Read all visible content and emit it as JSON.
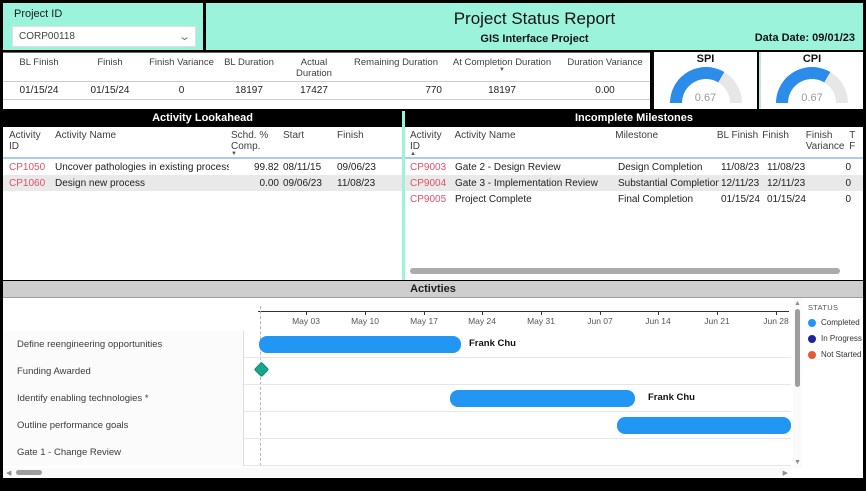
{
  "filter": {
    "label": "Project ID",
    "value": "CORP00118"
  },
  "header": {
    "title": "Project Status Report",
    "subtitle": "GIS Interface Project",
    "data_date": "Data Date: 09/01/23"
  },
  "summary": {
    "columns": [
      "BL Finish",
      "Finish",
      "Finish Variance",
      "BL Duration",
      "Actual Duration",
      "Remaining Duration",
      "At Completion Duration",
      "Duration Variance"
    ],
    "values": [
      "01/15/24",
      "01/15/24",
      "0",
      "18197",
      "17427",
      "770",
      "18197",
      "0.00"
    ],
    "sort": {
      "column": "At Completion Duration",
      "direction": "descending",
      "glyph": "▼"
    }
  },
  "gauges": {
    "spi": {
      "label": "SPI",
      "value": "0.67"
    },
    "cpi": {
      "label": "CPI",
      "value": "0.67"
    },
    "fill_color": "#2b8cea",
    "track_color": "#e7e7e7"
  },
  "lookahead": {
    "title": "Activity Lookahead",
    "columns": {
      "id": "Activity ID",
      "name": "Activity Name",
      "pct": "Schd. % Comp.",
      "start": "Start",
      "finish": "Finish"
    },
    "sort": {
      "column": "Schd. % Comp.",
      "direction": "descending",
      "glyph": "▼"
    },
    "rows": [
      {
        "id": "CP1050",
        "name": "Uncover pathologies in existing processes",
        "pct": "99.82",
        "start": "08/11/15",
        "finish": "09/06/23"
      },
      {
        "id": "CP1060",
        "name": "Design new process",
        "pct": "0.00",
        "start": "09/06/23",
        "finish": "11/08/23"
      }
    ]
  },
  "milestones": {
    "title": "Incomplete Milestones",
    "columns": {
      "id": "Activity ID",
      "name": "Activity Name",
      "milestone": "Milestone",
      "bl_finish": "BL Finish",
      "finish": "Finish",
      "variance": "Finish Variance",
      "clipped_line1": "T",
      "clipped_line2": "F"
    },
    "sort": {
      "column": "Activity ID",
      "direction": "ascending",
      "glyph": "▲"
    },
    "rows": [
      {
        "id": "CP9003",
        "name": "Gate 2 - Design Review",
        "milestone": "Design Completion",
        "bl_finish": "11/08/23",
        "finish": "11/08/23",
        "variance": "0"
      },
      {
        "id": "CP9004",
        "name": "Gate 3 - Implementation Review",
        "milestone": "Substantial Completion",
        "bl_finish": "12/11/23",
        "finish": "12/11/23",
        "variance": "0"
      },
      {
        "id": "CP9005",
        "name": "Project Complete",
        "milestone": "Final Completion",
        "bl_finish": "01/15/24",
        "finish": "01/15/24",
        "variance": "0"
      }
    ]
  },
  "gantt": {
    "title": "Activties",
    "axis": [
      "May 03",
      "May 10",
      "May 17",
      "May 24",
      "May 31",
      "Jun 07",
      "Jun 14",
      "Jun 21",
      "Jun 28"
    ],
    "legend": {
      "title": "STATUS",
      "items": [
        {
          "label": "Completed",
          "color": "#2196f3"
        },
        {
          "label": "In Progress",
          "color": "#1f249c"
        },
        {
          "label": "Not Started",
          "color": "#e4593b"
        }
      ]
    },
    "tasks": [
      {
        "name": "Define reengineering opportunities",
        "assignee": "Frank Chu",
        "status": "Completed",
        "shape": "bar"
      },
      {
        "name": "Funding Awarded",
        "status": "Completed",
        "shape": "milestone-diamond"
      },
      {
        "name": "Identify enabling technologies *",
        "assignee": "Frank Chu",
        "status": "Completed",
        "shape": "bar"
      },
      {
        "name": "Outline performance goals",
        "status": "Completed",
        "shape": "bar"
      },
      {
        "name": "Gate 1 - Change Review",
        "shape": "none"
      }
    ]
  },
  "colors": {
    "header_teal": "#9cf3dc",
    "activity_id_red": "#e25069",
    "gantt_bar_blue": "#2196f3",
    "milestone_diamond_teal": "#17a68e",
    "section_bar_black": "#000000"
  }
}
